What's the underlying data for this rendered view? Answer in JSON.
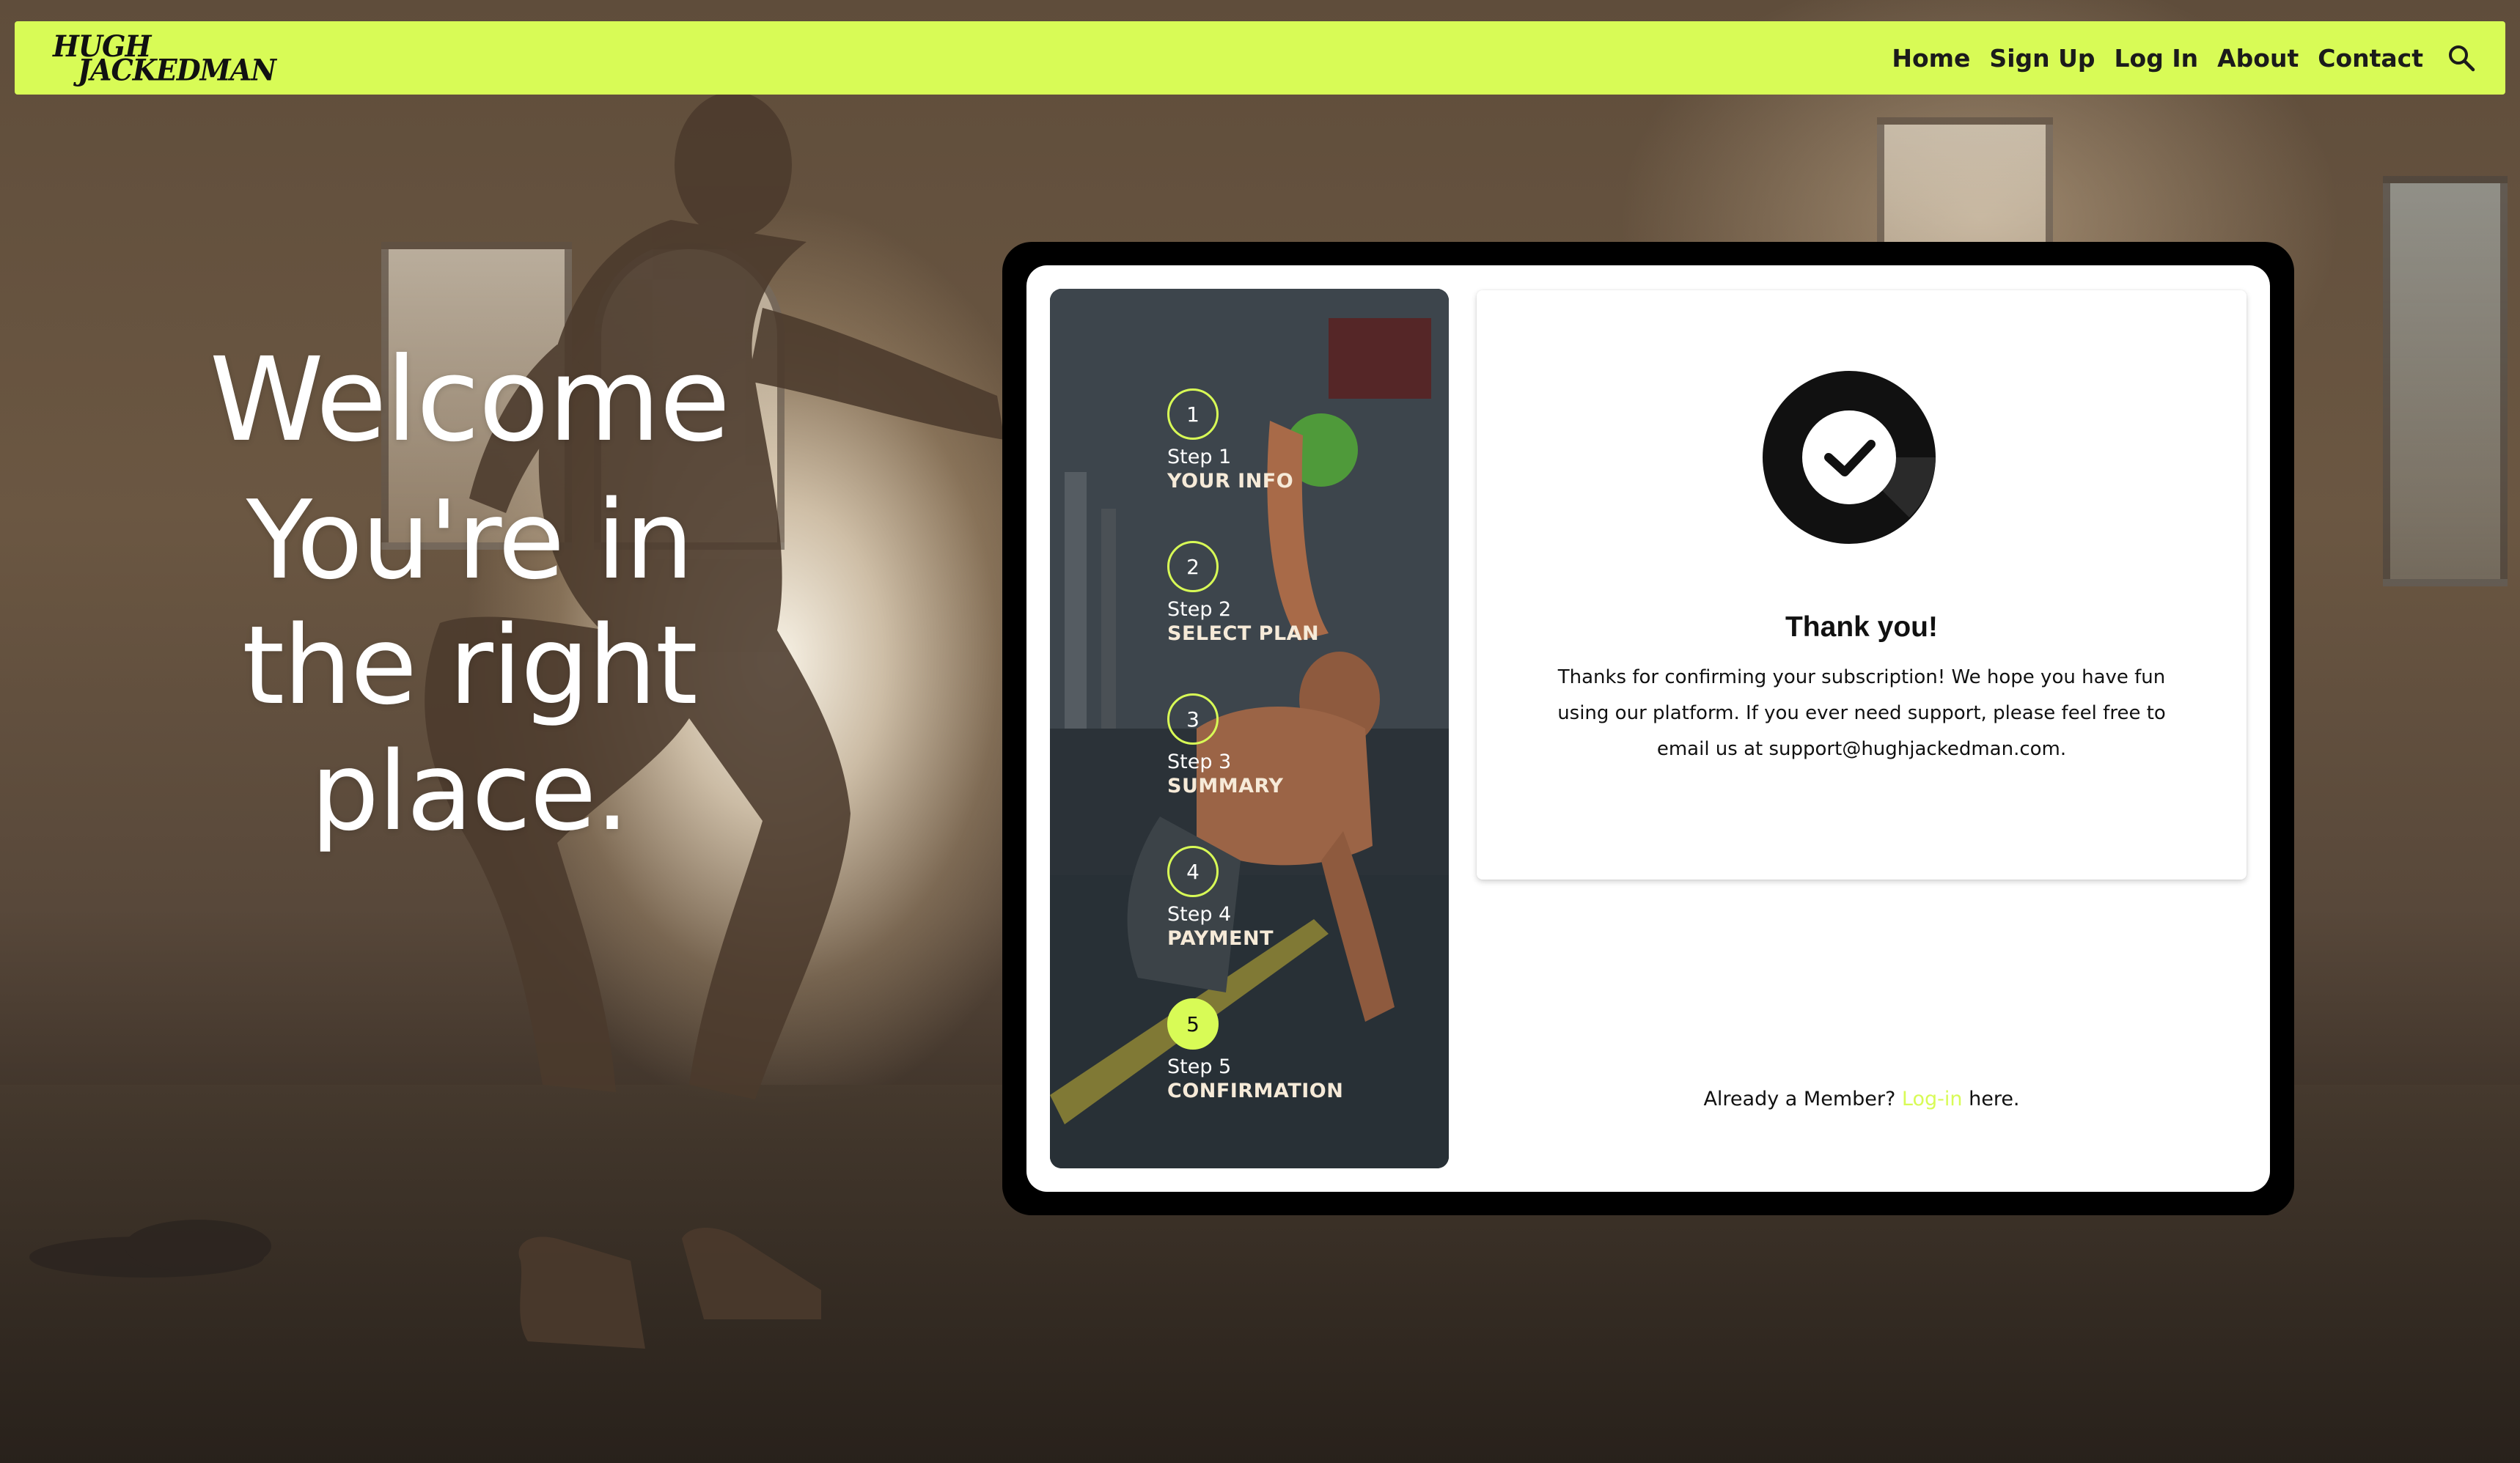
{
  "brand": {
    "logo_line1": "HUGH",
    "logo_line2": "JACKEDMAN",
    "accent_color": "#d8fb56",
    "logo_color": "#111111"
  },
  "nav": {
    "items": [
      {
        "label": "Home"
      },
      {
        "label": "Sign Up"
      },
      {
        "label": "Log In"
      },
      {
        "label": "About"
      },
      {
        "label": "Contact"
      }
    ],
    "search_icon": "search-icon"
  },
  "hero": {
    "welcome": "Welcome",
    "tagline": "You're in the right place."
  },
  "steps": [
    {
      "number": "1",
      "step": "Step 1",
      "label": "YOUR INFO",
      "active": false
    },
    {
      "number": "2",
      "step": "Step 2",
      "label": "SELECT PLAN",
      "active": false
    },
    {
      "number": "3",
      "step": "Step 3",
      "label": "SUMMARY",
      "active": false
    },
    {
      "number": "4",
      "step": "Step 4",
      "label": "PAYMENT",
      "active": false
    },
    {
      "number": "5",
      "step": "Step 5",
      "label": "CONFIRMATION",
      "active": true
    }
  ],
  "confirmation": {
    "icon": "check-circle-icon",
    "title": "Thank you!",
    "body": "Thanks for confirming your subscription! We hope you have fun using our platform. If you ever need support, please feel free to email us at support@hughjackedman.com."
  },
  "member": {
    "prefix": "Already a Member?",
    "link": "Log-in",
    "suffix": "here."
  }
}
